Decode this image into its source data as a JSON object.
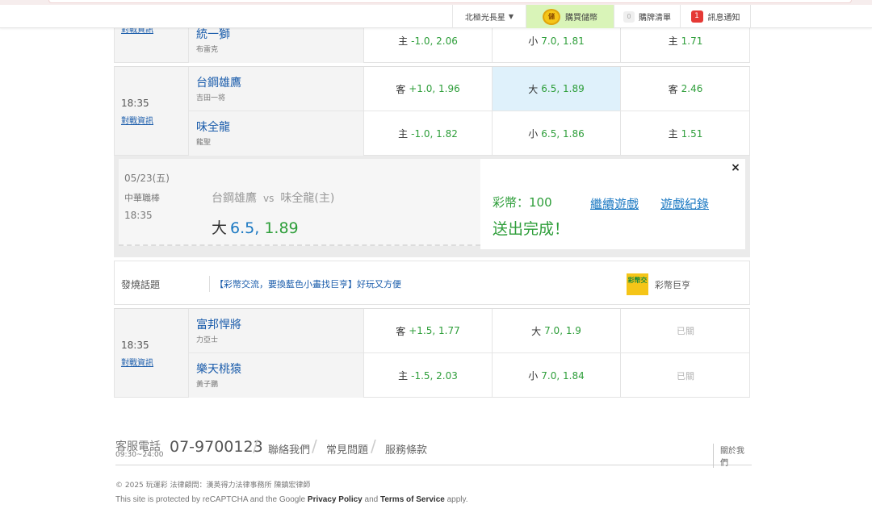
{
  "topbar": {
    "user_label": "北極光長星",
    "coin_text": "儲",
    "buy_label": "購買儲幣",
    "cart_count": "0",
    "cart_label": "購牌清單",
    "msg_count": "1",
    "msg_label": "訊息通知"
  },
  "game1": {
    "info_link": "對戰資訊",
    "team": "統一獅",
    "pitcher": "布雷克",
    "spread_side": "主",
    "spread_value": "-1.0, 2.06",
    "total_side": "小",
    "total_value": "7.0, 1.81",
    "ml_side": "主",
    "ml_value": "1.71"
  },
  "game2": {
    "time": "18:35",
    "info_link": "對戰資訊",
    "rows": [
      {
        "team": "台鋼雄鷹",
        "pitcher": "吉田一将",
        "spread_side": "客",
        "spread_value": "+1.0, 1.96",
        "total_side": "大",
        "total_value": "6.5, 1.89",
        "ml_side": "客",
        "ml_value": "2.46"
      },
      {
        "team": "味全龍",
        "pitcher": "龍聖",
        "spread_side": "主",
        "spread_value": "-1.0, 1.82",
        "total_side": "小",
        "total_value": "6.5, 1.86",
        "ml_side": "主",
        "ml_value": "1.51"
      }
    ]
  },
  "ticket": {
    "date": "05/23(五)",
    "league": "中華職棒",
    "time": "18:35",
    "away": "台鋼雄鷹",
    "vs": "vs",
    "home": "味全龍(主)",
    "pick_side": "大",
    "pick_line": "6.5,",
    "pick_odds": "1.89",
    "coin_text": "彩幣：100",
    "continue_link": "繼續遊戲",
    "record_link": "遊戲紀錄",
    "done_text": "送出完成！",
    "close": "×"
  },
  "topic": {
    "label": "發燒話題",
    "text": "【彩幣交流，要換藍色小畫找巨亨】好玩又方便",
    "badge": "彩幣交",
    "user": "彩幣巨亨"
  },
  "game3": {
    "time": "18:35",
    "info_link": "對戰資訊",
    "rows": [
      {
        "team": "富邦悍將",
        "pitcher": "力亞士",
        "spread_side": "客",
        "spread_value": "+1.5, 1.77",
        "total_side": "大",
        "total_value": "7.0, 1.9",
        "ml_closed": "已關"
      },
      {
        "team": "樂天桃猿",
        "pitcher": "黃子鵬",
        "spread_side": "主",
        "spread_value": "-1.5, 2.03",
        "total_side": "小",
        "total_value": "7.0, 1.84",
        "ml_closed": "已關"
      }
    ]
  },
  "footer": {
    "service_label": "客服電話",
    "hours": "09:30~24:00",
    "phone": "07-9700123",
    "links": [
      "聯絡我們",
      "常見問題",
      "服務條款"
    ],
    "about": "關於我們",
    "copyright": "© 2025 玩運彩 法律顧問：漢英得力法律事務所 陳鎮宏律師",
    "recaptcha_pre": "This site is protected by reCAPTCHA and the Google",
    "privacy": "Privacy Policy",
    "and": "and",
    "terms": "Terms of Service",
    "apply": "apply."
  }
}
